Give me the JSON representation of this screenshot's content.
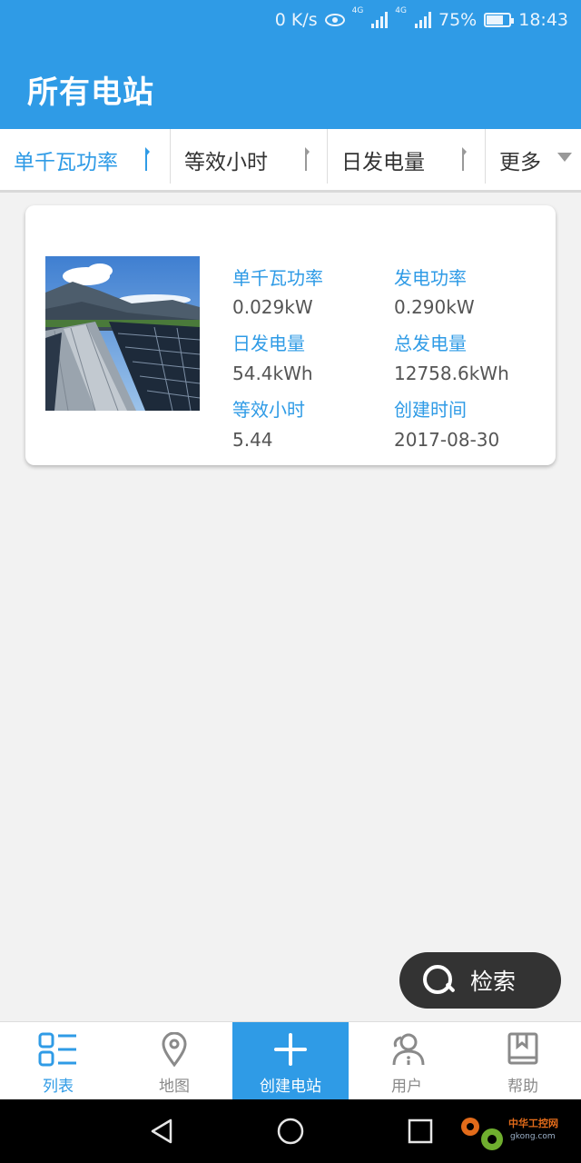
{
  "status_bar": {
    "network_speed": "0 K/s",
    "net_type_1": "4G",
    "net_type_2": "4G",
    "battery": "75%",
    "battery_level": 0.75,
    "time": "18:43",
    "icons": [
      "eye-icon",
      "signal-icon",
      "signal-icon",
      "battery-icon"
    ]
  },
  "header": {
    "title": "所有电站"
  },
  "sort_bar": {
    "items": [
      {
        "label": "单千瓦功率",
        "active": true
      },
      {
        "label": "等效小时",
        "active": false
      },
      {
        "label": "日发电量",
        "active": false
      }
    ],
    "more_label": "更多"
  },
  "stations": [
    {
      "fields": [
        {
          "label": "单千瓦功率",
          "value": "0.029kW"
        },
        {
          "label": "发电功率",
          "value": "0.290kW"
        },
        {
          "label": "日发电量",
          "value": "54.4kWh"
        },
        {
          "label": "总发电量",
          "value": "12758.6kWh"
        },
        {
          "label": "等效小时",
          "value": "5.44"
        },
        {
          "label": "创建时间",
          "value": "2017-08-30"
        }
      ]
    }
  ],
  "search_fab": {
    "label": "检索"
  },
  "bottom_nav": {
    "items": [
      {
        "label": "列表",
        "icon": "list-icon"
      },
      {
        "label": "地图",
        "icon": "map-pin-icon"
      },
      {
        "label": "创建电站",
        "icon": "plus-icon"
      },
      {
        "label": "用户",
        "icon": "user-icon"
      },
      {
        "label": "帮助",
        "icon": "book-icon"
      }
    ]
  },
  "watermark": {
    "text": "中华工控网",
    "url_text": "gkong.com"
  },
  "colors": {
    "primary": "#2f9be6",
    "fab": "#333333",
    "background": "#f2f2f2"
  }
}
